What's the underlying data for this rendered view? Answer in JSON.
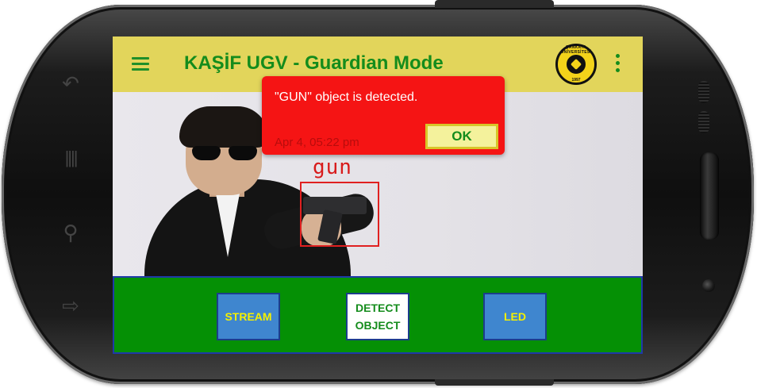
{
  "appbar": {
    "title": "KAŞİF UGV - Guardian Mode",
    "logo_text": "ÇANKAYA ÜNİVERSİTESİ",
    "logo_year": "1997"
  },
  "detection": {
    "label": "gun"
  },
  "dialog": {
    "message": "\"GUN\" object is detected.",
    "timestamp": "Apr 4, 05:22 pm",
    "ok_label": "OK"
  },
  "controls": {
    "stream_label": "STREAM",
    "detect_label": "DETECT OBJECT",
    "led_label": "LED"
  },
  "device": {
    "side_icons": [
      "back-icon",
      "menu-icon",
      "search-icon",
      "home-icon"
    ]
  },
  "colors": {
    "appbar": "#e2d55b",
    "title": "#148c1c",
    "dialog": "#f51414",
    "controls": "#059005",
    "button_blue": "#3f86cf",
    "button_text_yellow": "#f5f000",
    "detection_box": "#e02020"
  }
}
